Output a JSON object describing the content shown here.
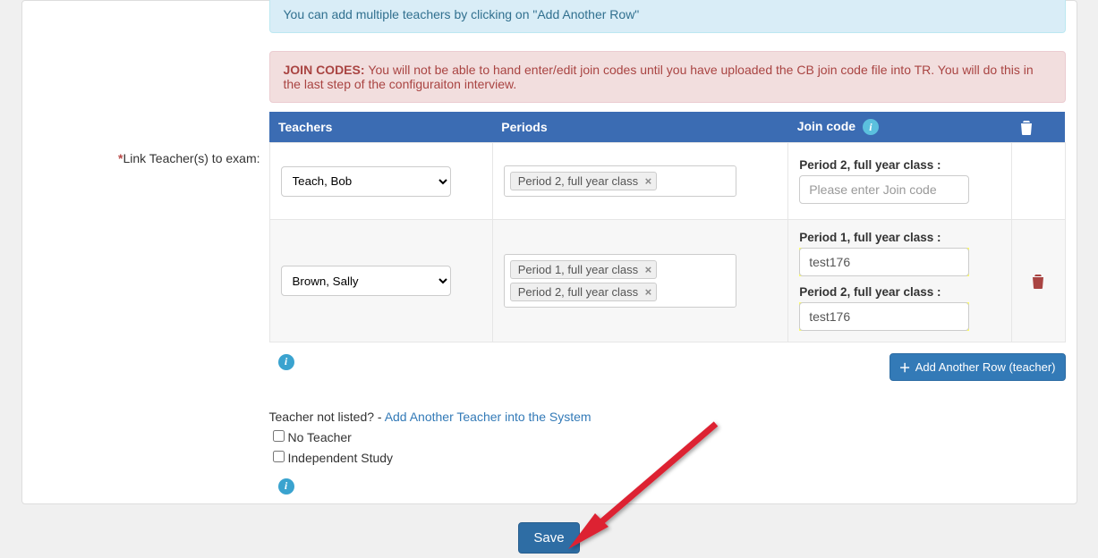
{
  "alerts": {
    "info_text": "You can add multiple teachers by clicking on \"Add Another Row\"",
    "warn_prefix": "JOIN CODES: ",
    "warn_text": "You will not be able to hand enter/edit join codes until you have uploaded the CB join code file into TR. You will do this in the last step of the configuraiton interview."
  },
  "form_label": "Link Teacher(s) to exam:",
  "headers": {
    "teachers": "Teachers",
    "periods": "Periods",
    "join_code": "Join code"
  },
  "rows": [
    {
      "teacher": "Teach, Bob",
      "periods": [
        "Period 2, full year class"
      ],
      "join_codes": [
        {
          "label": "Period 2, full year class :",
          "value": "",
          "placeholder": "Please enter Join code",
          "highlight": false
        }
      ],
      "can_delete": false
    },
    {
      "teacher": "Brown, Sally",
      "periods": [
        "Period 1, full year class",
        "Period 2, full year class"
      ],
      "join_codes": [
        {
          "label": "Period 1, full year class :",
          "value": "test176",
          "placeholder": "",
          "highlight": true
        },
        {
          "label": "Period 2, full year class :",
          "value": "test176",
          "placeholder": "",
          "highlight": true
        }
      ],
      "can_delete": true
    }
  ],
  "below": {
    "add_row_label": "Add Another Row (teacher)",
    "not_listed_prefix": "Teacher not listed? - ",
    "not_listed_link": "Add Another Teacher into the System",
    "no_teacher_label": "No Teacher",
    "independent_label": "Independent Study"
  },
  "save_label": "Save",
  "colors": {
    "header_bg": "#3b6cb3",
    "link": "#337ab7",
    "highlight": "#ffff66",
    "delete": "#a94442"
  }
}
